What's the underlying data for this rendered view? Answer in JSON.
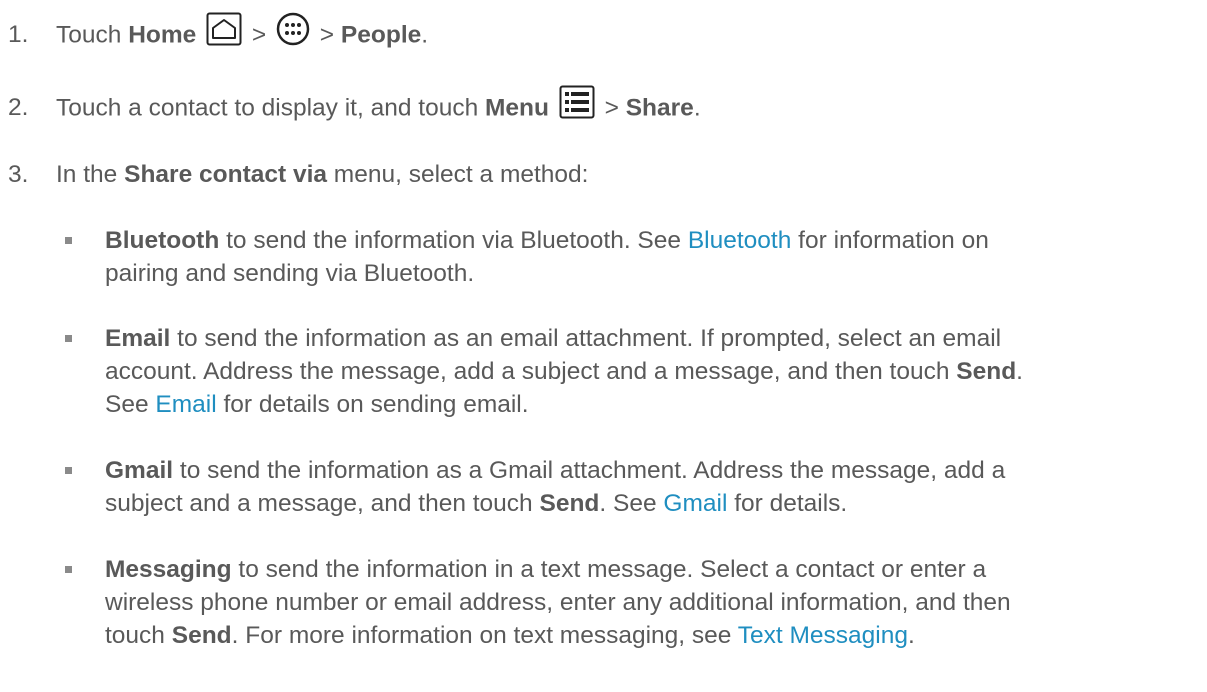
{
  "steps": [
    {
      "num": "1.",
      "t1": "Touch ",
      "b1": "Home",
      "sep1": " > ",
      "sep2": " > ",
      "b2": "People",
      "end": "."
    },
    {
      "num": "2.",
      "t1": "Touch a contact to display it, and touch ",
      "b1": "Menu",
      "sep": " > ",
      "b2": "Share",
      "end": "."
    },
    {
      "num": "3.",
      "t1": "In the ",
      "b1": "Share contact via",
      "t2": " menu, select a method:"
    }
  ],
  "methods": [
    {
      "name": "Bluetooth",
      "l1a": " to send the information via Bluetooth. See ",
      "link": "Bluetooth",
      "l1b": " for information on",
      "l2": "pairing and sending via Bluetooth."
    },
    {
      "name": "Email",
      "l1": " to send the information as an email attachment. If prompted, select an email",
      "l2a": "account. Address the message, add a subject and a message, and then touch ",
      "send": "Send",
      "l2b": ".",
      "l3a": "See ",
      "link": "Email",
      "l3b": " for details on sending email."
    },
    {
      "name": "Gmail",
      "l1": " to send the information as a Gmail attachment. Address the message, add a",
      "l2a": "subject and a message, and then touch ",
      "send": "Send",
      "l2b": ". See ",
      "link": "Gmail",
      "l2c": " for details."
    },
    {
      "name": "Messaging",
      "l1": " to send the information in a text message. Select a contact or enter a",
      "l2": "wireless phone number or email address, enter any additional information, and then",
      "l3a": "touch ",
      "send": "Send",
      "l3b": ". For more information on text messaging, see ",
      "link": "Text Messaging",
      "l3c": "."
    }
  ],
  "icons": [
    "home-icon",
    "apps-icon",
    "menu-icon"
  ],
  "colors": {
    "text": "#595959",
    "link": "#1f8ec0"
  }
}
